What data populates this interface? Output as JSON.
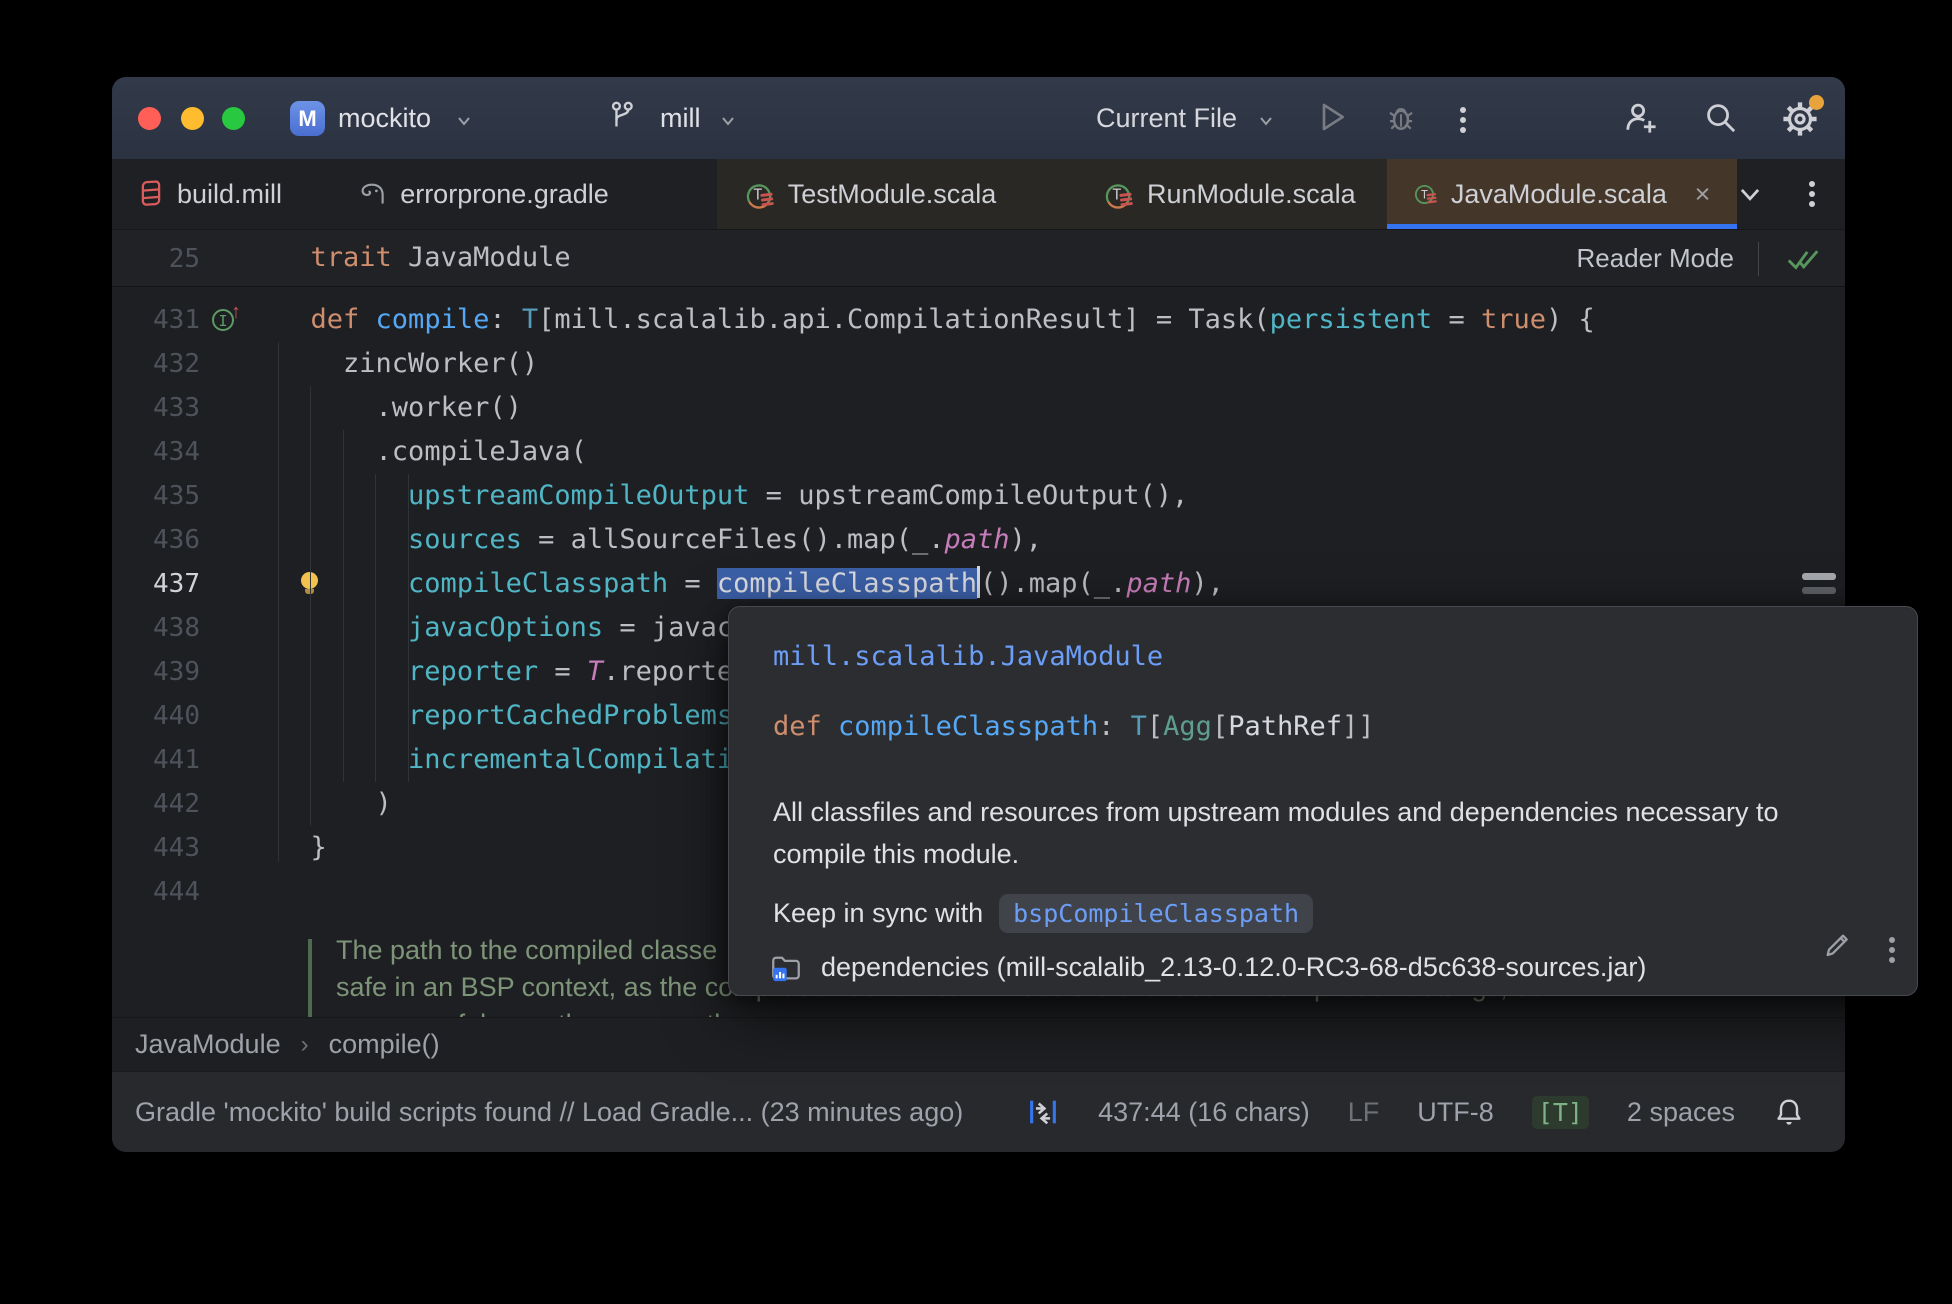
{
  "title_bar": {
    "project_initial": "M",
    "project_name": "mockito",
    "branch_name": "mill",
    "run_config": "Current File"
  },
  "tabs": [
    {
      "label": "build.mill"
    },
    {
      "label": "errorprone.gradle"
    },
    {
      "label": "TestModule.scala"
    },
    {
      "label": "RunModule.scala"
    },
    {
      "label": "JavaModule.scala"
    }
  ],
  "sticky_line": {
    "num": "25",
    "indent": 2,
    "segments": [
      {
        "t": "trait",
        "s": "kw"
      },
      {
        "t": " JavaModule",
        "s": "pl"
      }
    ],
    "reader_mode_label": "Reader Mode"
  },
  "editor": {
    "lines": [
      {
        "num": "431",
        "indent": 2,
        "gutter": "override",
        "segments": [
          {
            "t": "def ",
            "s": "kw"
          },
          {
            "t": "compile",
            "s": "fn"
          },
          {
            "t": ": ",
            "s": "pl"
          },
          {
            "t": "T",
            "s": "type-dim"
          },
          {
            "t": "[mill.scalalib.api.CompilationResult] = Task(",
            "s": "pl"
          },
          {
            "t": "persistent",
            "s": "arg"
          },
          {
            "t": " = ",
            "s": "pl"
          },
          {
            "t": "true",
            "s": "kw"
          },
          {
            "t": ") {",
            "s": "pl"
          }
        ]
      },
      {
        "num": "432",
        "indent": 4,
        "segments": [
          {
            "t": "zincWorker()",
            "s": "pl"
          }
        ]
      },
      {
        "num": "433",
        "indent": 6,
        "segments": [
          {
            "t": ".worker()",
            "s": "pl"
          }
        ]
      },
      {
        "num": "434",
        "indent": 6,
        "segments": [
          {
            "t": ".compileJava(",
            "s": "pl"
          }
        ]
      },
      {
        "num": "435",
        "indent": 8,
        "segments": [
          {
            "t": "upstreamCompileOutput",
            "s": "arg"
          },
          {
            "t": " = upstreamCompileOutput(),",
            "s": "pl"
          }
        ]
      },
      {
        "num": "436",
        "indent": 8,
        "segments": [
          {
            "t": "sources",
            "s": "arg"
          },
          {
            "t": " = allSourceFiles().map(_.",
            "s": "pl"
          },
          {
            "t": "path",
            "s": "field"
          },
          {
            "t": "),",
            "s": "pl"
          }
        ]
      },
      {
        "num": "437",
        "indent": 8,
        "gutter": "bulb",
        "current": true,
        "segments": [
          {
            "t": "compileClasspath",
            "s": "arg"
          },
          {
            "t": " = ",
            "s": "pl"
          },
          {
            "t": "compileClasspath",
            "s": "sel"
          },
          {
            "t": "",
            "s": "caret"
          },
          {
            "t": "().map(_.",
            "s": "pl"
          },
          {
            "t": "path",
            "s": "field"
          },
          {
            "t": "),",
            "s": "pl"
          }
        ]
      },
      {
        "num": "438",
        "indent": 8,
        "segments": [
          {
            "t": "javacOptions",
            "s": "arg"
          },
          {
            "t": " = javacO",
            "s": "pl"
          }
        ]
      },
      {
        "num": "439",
        "indent": 8,
        "segments": [
          {
            "t": "reporter",
            "s": "arg"
          },
          {
            "t": " = ",
            "s": "pl"
          },
          {
            "t": "T",
            "s": "field"
          },
          {
            "t": ".reporter",
            "s": "pl"
          }
        ]
      },
      {
        "num": "440",
        "indent": 8,
        "segments": [
          {
            "t": "reportCachedProblems",
            "s": "arg"
          }
        ]
      },
      {
        "num": "441",
        "indent": 8,
        "segments": [
          {
            "t": "incrementalCompilatio",
            "s": "arg"
          }
        ]
      },
      {
        "num": "442",
        "indent": 6,
        "segments": [
          {
            "t": ")",
            "s": "pl"
          }
        ]
      },
      {
        "num": "443",
        "indent": 2,
        "segments": [
          {
            "t": "}",
            "s": "pl"
          }
        ]
      },
      {
        "num": "444",
        "indent": 0,
        "segments": []
      }
    ],
    "doc_comment_lines": [
      "The path to the compiled classe",
      "safe in an BSP context, as the compilation done later will use the exact same compilation settings, so",
      "we can safely use the same path."
    ]
  },
  "popup": {
    "qualifier": "mill.scalalib.JavaModule",
    "signature": [
      {
        "t": "def ",
        "s": "kw"
      },
      {
        "t": "compileClasspath",
        "s": "fn"
      },
      {
        "t": ": ",
        "s": "pl"
      },
      {
        "t": "T",
        "s": "type-dim"
      },
      {
        "t": "[",
        "s": "pl"
      },
      {
        "t": "Agg",
        "s": "type"
      },
      {
        "t": "[",
        "s": "pl"
      },
      {
        "t": "PathRef",
        "s": "type-light"
      },
      {
        "t": "]]",
        "s": "pl"
      }
    ],
    "description_lines": [
      "All classfiles and resources from upstream modules and dependencies necessary to",
      "compile this module."
    ],
    "sync_label": "Keep in sync with",
    "sync_code": "bspCompileClasspath",
    "footer_text": "dependencies (mill-scalalib_2.13-0.12.0-RC3-68-d5c638-sources.jar)"
  },
  "breadcrumbs": {
    "items": [
      "JavaModule",
      "compile()"
    ],
    "separator": "›"
  },
  "status_bar": {
    "left_text": "Gradle 'mockito' build scripts found // Load Gradle... (23 minutes ago)",
    "position": "437:44 (16 chars)",
    "line_ending": "LF",
    "encoding": "UTF-8",
    "scope_badge": "[T]",
    "indent_info": "2 spaces"
  },
  "icons": {
    "override_arrow": "↑"
  },
  "colors": {
    "accent_blue": "#3574F0",
    "selection": "#3B5FA6",
    "keyword": "#CF8E6D",
    "function": "#56A8F5",
    "named_arg": "#50B6C6",
    "field_purple": "#C77DBB",
    "doc_green": "#7D9478",
    "link_blue": "#6C9EF8",
    "notification_dot": "#E8A33D",
    "traffic_red": "#FF5F57",
    "traffic_yellow": "#FEBC2E",
    "traffic_green": "#28C840"
  }
}
